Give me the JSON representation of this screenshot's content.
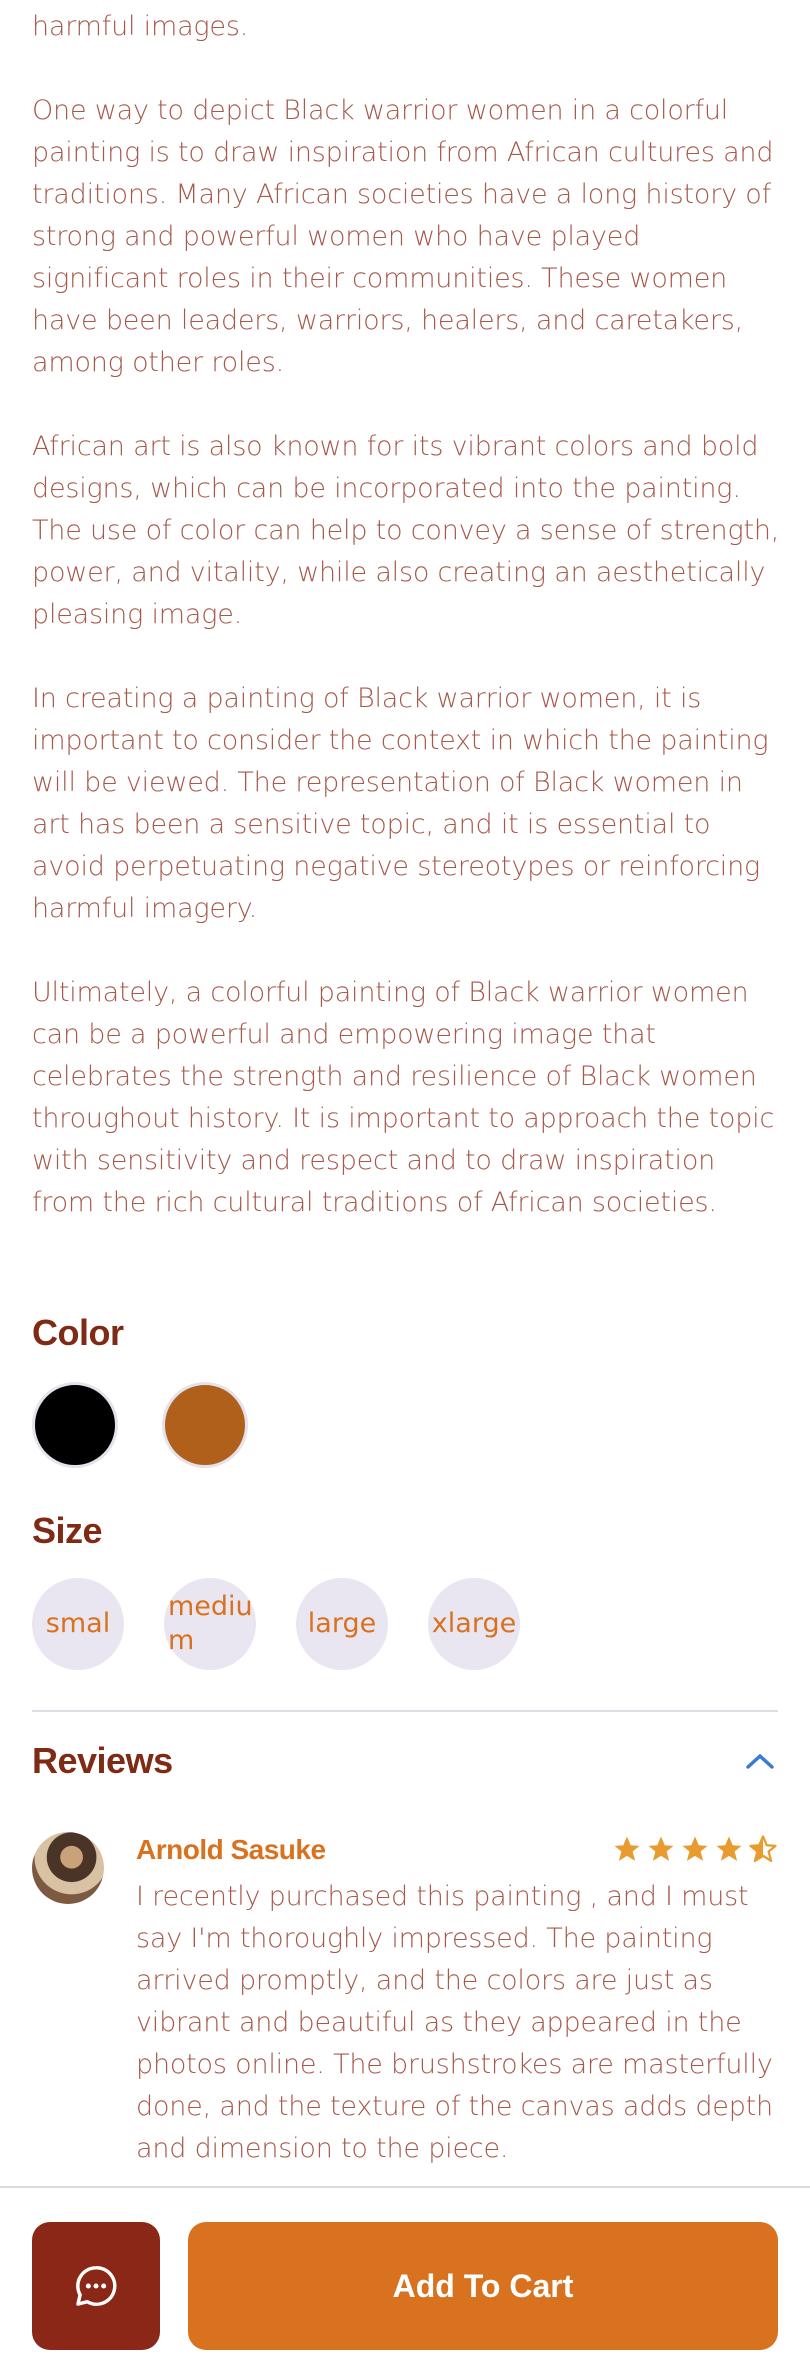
{
  "description": {
    "paragraphs": [
      "harmful images.",
      "One way to depict Black warrior women in a colorful painting is to draw inspiration from African cultures and traditions. Many African societies have a long history of strong and powerful women who have played significant roles in their communities. These women have been leaders, warriors, healers, and caretakers, among other roles.",
      "African art is also known for its vibrant colors and bold designs, which can be incorporated into the painting. The use of color can help to convey a sense of strength, power, and vitality, while also creating an aesthetically pleasing image.",
      "In creating a painting of Black warrior women, it is important to consider the context in which the painting will be viewed. The representation of Black women in art has been a sensitive topic, and it is essential to avoid perpetuating negative stereotypes or reinforcing harmful imagery.",
      "Ultimately, a colorful painting of Black warrior women can be a powerful and empowering image that celebrates the strength and resilience of Black women throughout history. It is important to approach the topic with sensitivity and respect and to draw inspiration from the rich cultural traditions of African societies."
    ]
  },
  "color_section": {
    "title": "Color",
    "swatches": [
      {
        "name": "black",
        "hex": "#000000"
      },
      {
        "name": "brown",
        "hex": "#b1601c"
      }
    ]
  },
  "size_section": {
    "title": "Size",
    "options": [
      "smal",
      "mediu m",
      "large",
      "xlarge"
    ]
  },
  "reviews": {
    "title": "Reviews",
    "items": [
      {
        "author": "Arnold Sasuke",
        "rating": 4.5,
        "text": "I recently purchased this painting , and I must say I'm thoroughly impressed. The painting arrived promptly, and the colors are just as vibrant and beautiful as they appeared in the photos online. The brushstrokes are masterfully done, and the texture of the canvas adds depth and dimension to the piece."
      }
    ]
  },
  "actions": {
    "chat_icon": "chat-bubble-icon",
    "add_to_cart_label": "Add To Cart"
  },
  "colors": {
    "primary": "#d9721f",
    "dark": "#8b2716",
    "text": "#a6584a",
    "heading": "#7f2a14",
    "chip_bg": "#e9e6f1",
    "star": "#e89b2e",
    "link": "#3b7bd4"
  }
}
